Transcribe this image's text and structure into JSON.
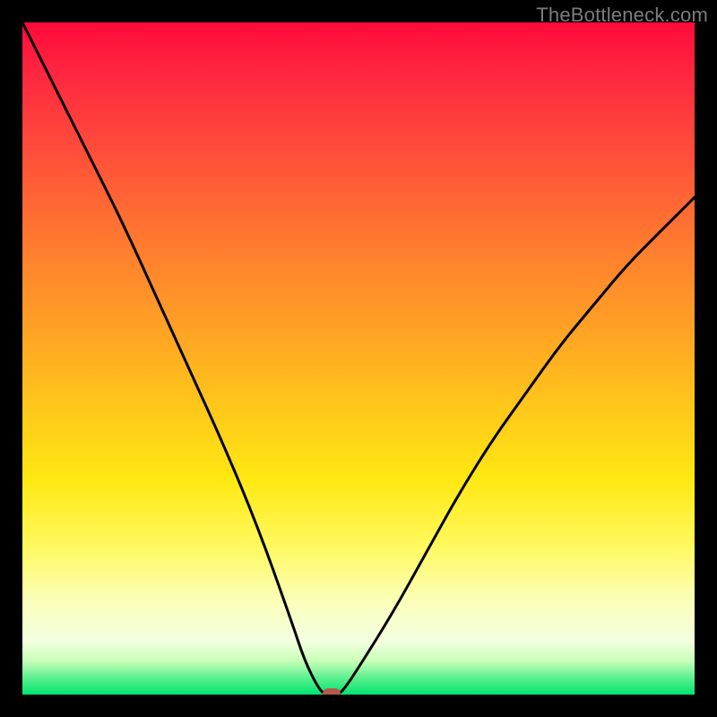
{
  "watermark_text": "TheBottleneck.com",
  "chart_data": {
    "type": "line",
    "title": "",
    "xlabel": "",
    "ylabel": "",
    "xlim": [
      0,
      100
    ],
    "ylim": [
      0,
      100
    ],
    "grid": false,
    "legend": false,
    "series": [
      {
        "name": "bottleneck-curve",
        "x": [
          0,
          5,
          10,
          15,
          20,
          25,
          30,
          35,
          40,
          42,
          44,
          45,
          47,
          48,
          50,
          55,
          60,
          65,
          70,
          75,
          80,
          85,
          90,
          95,
          100
        ],
        "values": [
          100,
          90,
          80,
          70,
          59,
          48,
          37,
          25,
          11,
          5,
          1,
          0,
          0,
          1,
          4,
          12,
          21,
          30,
          38,
          45,
          52,
          58,
          64,
          69,
          74
        ]
      }
    ],
    "marker": {
      "x": 46,
      "y": 0,
      "color": "#b55a4a"
    },
    "background_gradient": {
      "orientation": "vertical",
      "stops": [
        {
          "pos": 0.0,
          "color": "#ff0a3a"
        },
        {
          "pos": 0.34,
          "color": "#ff7e2e"
        },
        {
          "pos": 0.68,
          "color": "#ffe812"
        },
        {
          "pos": 0.92,
          "color": "#f3ffe0"
        },
        {
          "pos": 1.0,
          "color": "#00e472"
        }
      ]
    }
  }
}
